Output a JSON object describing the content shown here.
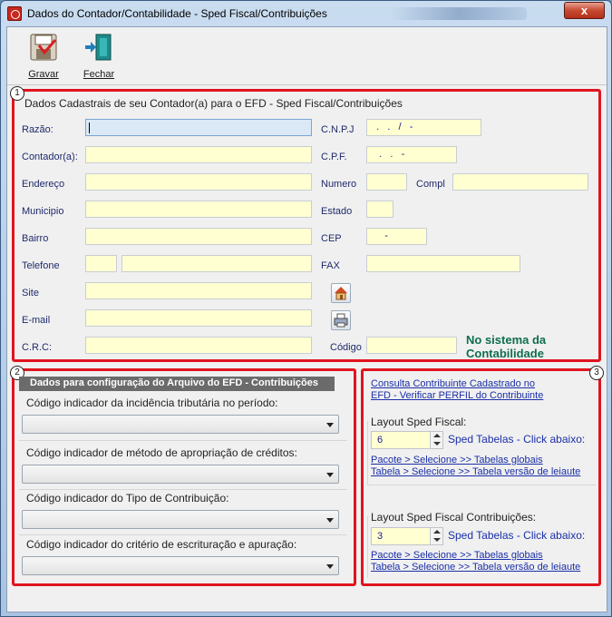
{
  "window": {
    "title": "Dados do Contador/Contabilidade - Sped Fiscal/Contribuições",
    "close_label": "x"
  },
  "toolbar": {
    "save_label": "Gravar",
    "close_label": "Fechar"
  },
  "section1": {
    "badge": "1",
    "title": "Dados Cadastrais de seu Contador(a) para o EFD - Sped Fiscal/Contribuições",
    "labels": {
      "razao": "Razão:",
      "contador": "Contador(a):",
      "endereco": "Endereço",
      "municipio": "Municipio",
      "bairro": "Bairro",
      "telefone": "Telefone",
      "site": "Site",
      "email": "E-mail",
      "crc": "C.R.C:",
      "cnpj": "C.N.P.J",
      "cpf": "C.P.F.",
      "numero": "Numero",
      "compl": "Compl",
      "estado": "Estado",
      "cep": "CEP",
      "fax": "FAX",
      "codigo": "Código"
    },
    "values": {
      "razao": "",
      "contador": "",
      "endereco": "",
      "municipio": "",
      "bairro": "",
      "telefone_ddd": "",
      "telefone": "",
      "site": "",
      "email": "",
      "crc": "",
      "cnpj": "  .   .   /   -",
      "cpf": "   .   .   -",
      "numero": "",
      "compl": "",
      "estado": "",
      "cep": "     -",
      "fax": "",
      "codigo": ""
    },
    "note_line1": "No sistema da",
    "note_line2": "Contabilidade"
  },
  "section2": {
    "badge": "2",
    "header": "Dados para configuração do Arquivo do EFD - Contribuições",
    "groups": [
      {
        "caption": "Código indicador da incidência tributária no período:",
        "value": ""
      },
      {
        "caption": "Código indicador de método de apropriação de créditos:",
        "value": ""
      },
      {
        "caption": "Código indicador do Tipo de Contribuição:",
        "value": ""
      },
      {
        "caption": "Código indicador do critério de escrituração e apuração:",
        "value": ""
      }
    ]
  },
  "section3": {
    "badge": "3",
    "link_consulta_1": "Consulta Contribuinte Cadastrado no",
    "link_consulta_2": "EFD - Verificar PERFIL do Contribuinte",
    "fiscal": {
      "caption": "Layout Sped Fiscal:",
      "value": "6",
      "tabelas_label": "Sped Tabelas - Click abaixo:",
      "link_pacote": "Pacote > Selecione >> Tabelas globais",
      "link_tabela": "Tabela > Selecione >> Tabela versão de leiaute"
    },
    "contrib": {
      "caption": "Layout Sped Fiscal Contribuições:",
      "value": "3",
      "tabelas_label": "Sped Tabelas - Click abaixo:",
      "link_pacote": "Pacote > Selecione >> Tabelas globais",
      "link_tabela": "Tabela > Selecione >> Tabela versão de leiaute"
    }
  }
}
